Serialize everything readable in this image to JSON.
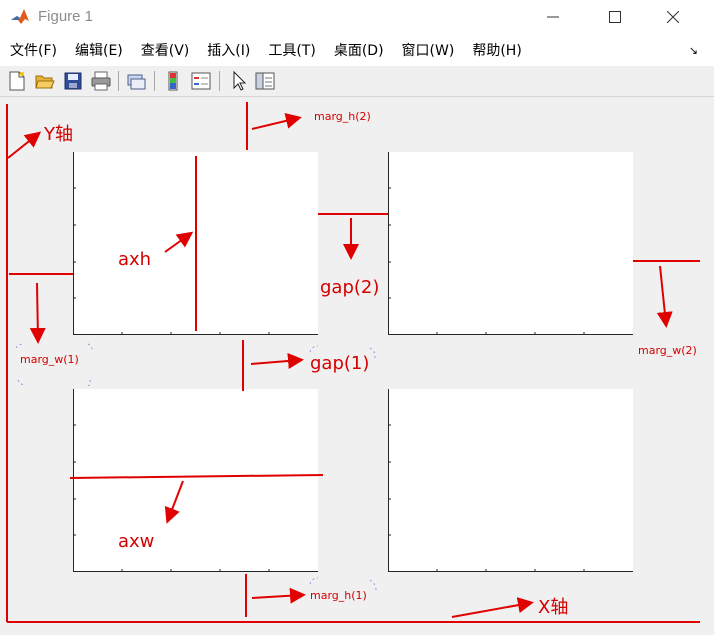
{
  "window": {
    "title": "Figure 1",
    "minimize_glyph": "—",
    "maximize_glyph": "☐",
    "close_glyph": "✕"
  },
  "menu": {
    "items": [
      "文件(F)",
      "编辑(E)",
      "查看(V)",
      "插入(I)",
      "工具(T)",
      "桌面(D)",
      "窗口(W)",
      "帮助(H)"
    ],
    "dock_glyph": "↘"
  },
  "toolbar": {
    "icons": [
      "new-figure-icon",
      "open-file-icon",
      "save-icon",
      "print-icon",
      "link-icon",
      "colorbar-icon",
      "legend-icon",
      "pointer-icon",
      "property-editor-icon"
    ]
  },
  "annotations": {
    "y_axis": "Y轴",
    "x_axis": "X轴",
    "marg_h2": "marg_h(2)",
    "marg_h1": "marg_h(1)",
    "marg_w1": "marg_w(1)",
    "marg_w2": "marg_w(2)",
    "gap2": "gap(2)",
    "gap1": "gap(1)",
    "axh": "axh",
    "axw": "axw"
  },
  "colors": {
    "annotation": "#e00000",
    "axes_bg": "#ffffff",
    "figure_bg": "#f0f0f0"
  }
}
